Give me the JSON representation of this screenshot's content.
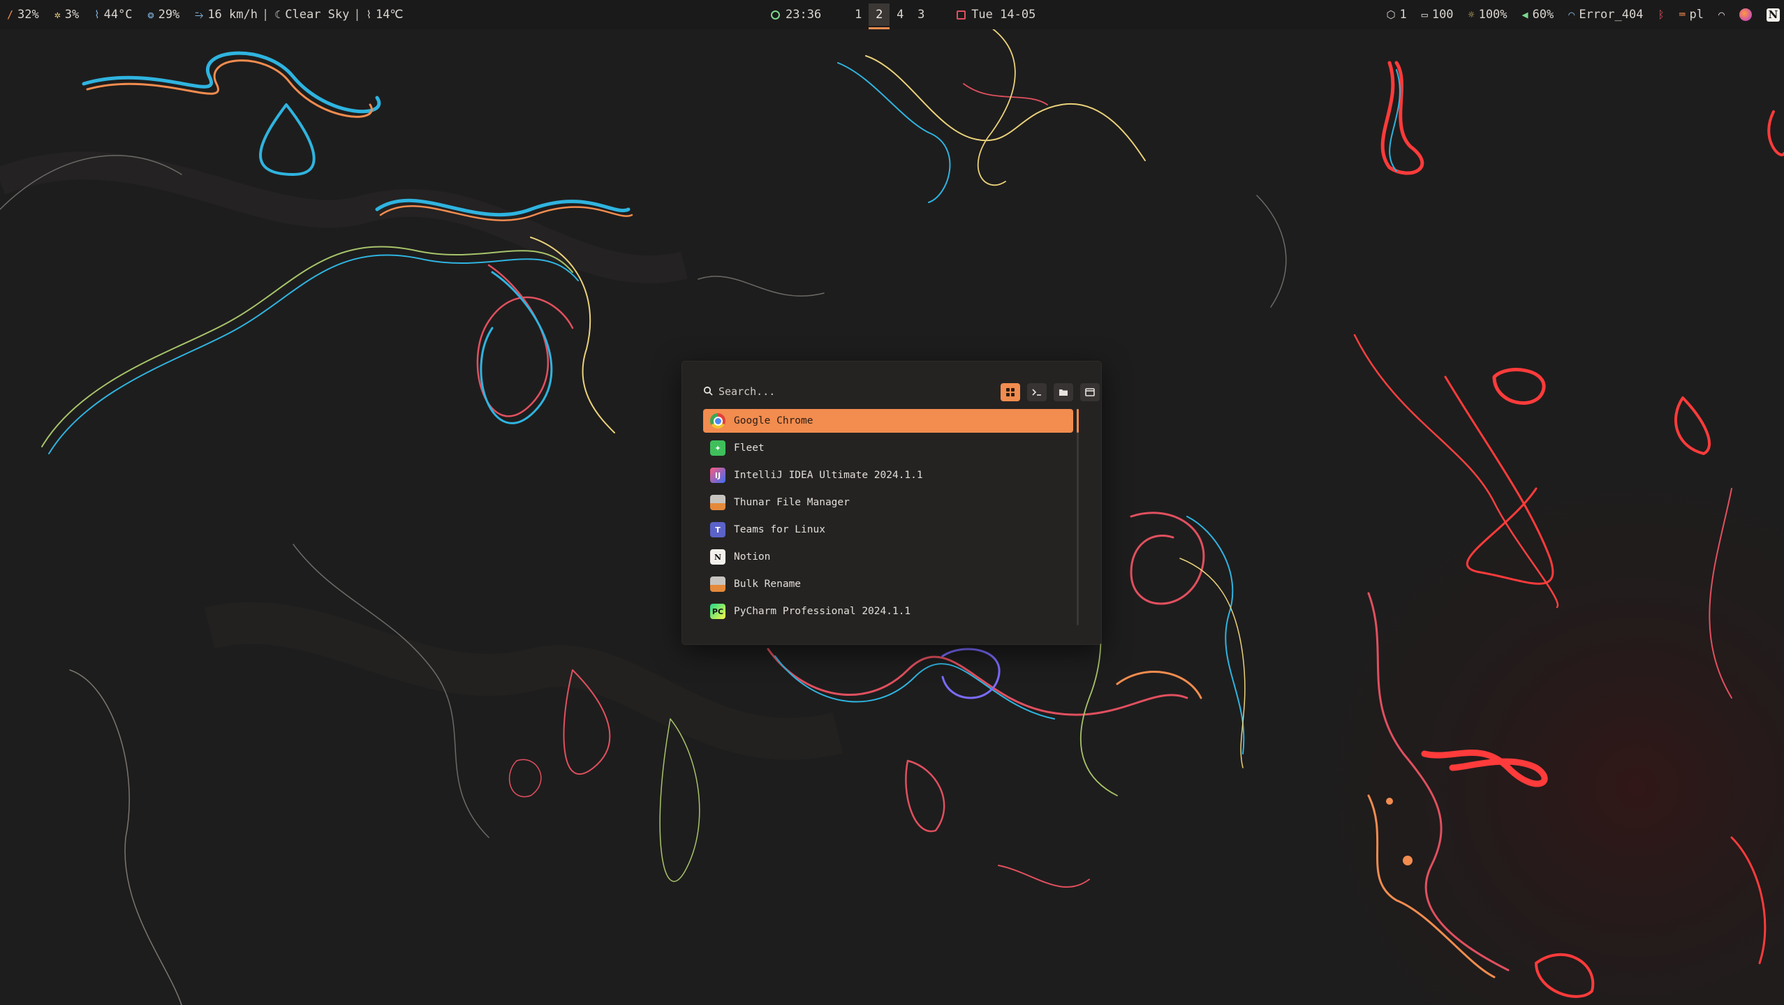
{
  "topbar": {
    "left": {
      "cpu": "32%",
      "gpu": "3%",
      "temperature": "44°C",
      "humidity": "29%",
      "wind": "16 km/h",
      "separator": "|",
      "weather": "Clear Sky",
      "outside_temp": "14℃"
    },
    "center": {
      "time": "23:36",
      "workspaces": [
        {
          "label": "1",
          "active": false
        },
        {
          "label": "2",
          "active": true
        },
        {
          "label": "4",
          "active": false
        },
        {
          "label": "3",
          "active": false
        }
      ],
      "date": "Tue 14-05"
    },
    "right": {
      "updates": "1",
      "battery": "100",
      "brightness": "100%",
      "volume": "60%",
      "network": "Error_404",
      "keyboard_layout": "pl"
    }
  },
  "launcher": {
    "search": {
      "placeholder": "Search...",
      "value": ""
    },
    "modes": [
      {
        "name": "apps",
        "icon": "grid-icon",
        "active": true
      },
      {
        "name": "run",
        "icon": "terminal-icon",
        "active": false
      },
      {
        "name": "files",
        "icon": "folder-icon",
        "active": false
      },
      {
        "name": "windows",
        "icon": "window-icon",
        "active": false
      }
    ],
    "results": [
      {
        "label": "Google Chrome",
        "icon": "chrome-icon",
        "selected": true
      },
      {
        "label": "Fleet",
        "icon": "fleet-icon",
        "selected": false
      },
      {
        "label": "IntelliJ IDEA Ultimate 2024.1.1",
        "icon": "intellij-icon",
        "selected": false
      },
      {
        "label": "Thunar File Manager",
        "icon": "thunar-icon",
        "selected": false
      },
      {
        "label": "Teams for Linux",
        "icon": "teams-icon",
        "selected": false
      },
      {
        "label": "Notion",
        "icon": "notion-icon",
        "selected": false
      },
      {
        "label": "Bulk Rename",
        "icon": "bulk-rename-icon",
        "selected": false
      },
      {
        "label": "PyCharm Professional 2024.1.1",
        "icon": "pycharm-icon",
        "selected": false
      }
    ]
  },
  "colors": {
    "accent": "#f28c4f",
    "bar_bg": "#1b1a1a",
    "launcher_bg": "#242322",
    "desktop_bg": "#1d1c1c"
  }
}
